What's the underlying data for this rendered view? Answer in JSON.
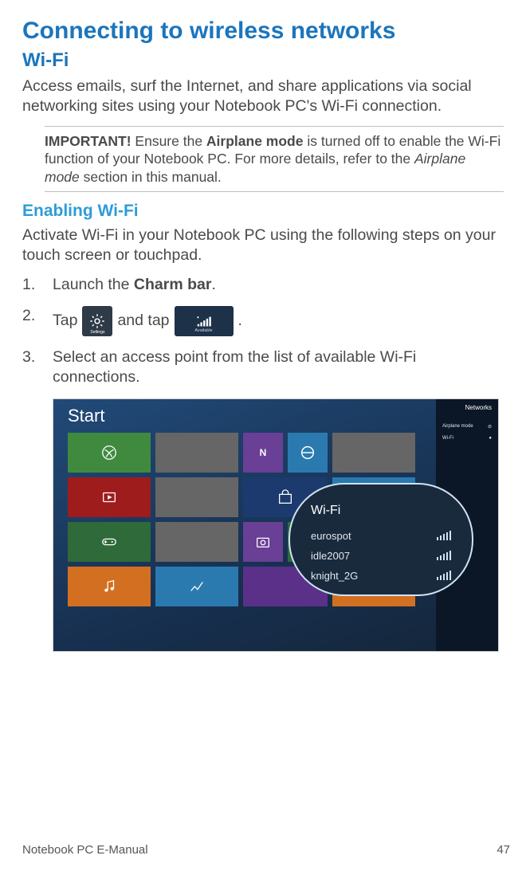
{
  "title": "Connecting to wireless networks",
  "section": "Wi-Fi",
  "intro": "Access emails, surf the Internet, and share applications via social networking sites using your Notebook PC's Wi-Fi connection.",
  "important": {
    "label": "IMPORTANT!",
    "text_before": " Ensure the ",
    "bold_term": "Airplane mode",
    "text_middle": " is turned off to enable the Wi-Fi function of your Notebook PC. For more details, refer to the ",
    "italic_term": "Airplane mode",
    "text_after": " section in this manual."
  },
  "enabling": {
    "heading": "Enabling Wi-Fi",
    "intro": "Activate Wi-Fi in your Notebook PC using the following steps on your touch screen or touchpad."
  },
  "steps": {
    "s1_num": "1.",
    "s1_a": "Launch the ",
    "s1_bold": "Charm bar",
    "s1_b": ".",
    "s2_num": "2.",
    "s2_a": "Tap ",
    "s2_b": " and tap ",
    "s2_c": " .",
    "settings_label": "Settings",
    "available_label": "Available",
    "s3_num": "3.",
    "s3_text": "Select an access point from the list of available Wi-Fi connections."
  },
  "screenshot": {
    "start": "Start",
    "networks_title": "Networks",
    "np_airplane": "Airplane mode",
    "np_wifi": "Wi-Fi",
    "wifi_title": "Wi-Fi",
    "net1": "eurospot",
    "net2": "idle2007",
    "net3": "knight_2G"
  },
  "footer": {
    "left": "Notebook PC E-Manual",
    "right": "47"
  }
}
